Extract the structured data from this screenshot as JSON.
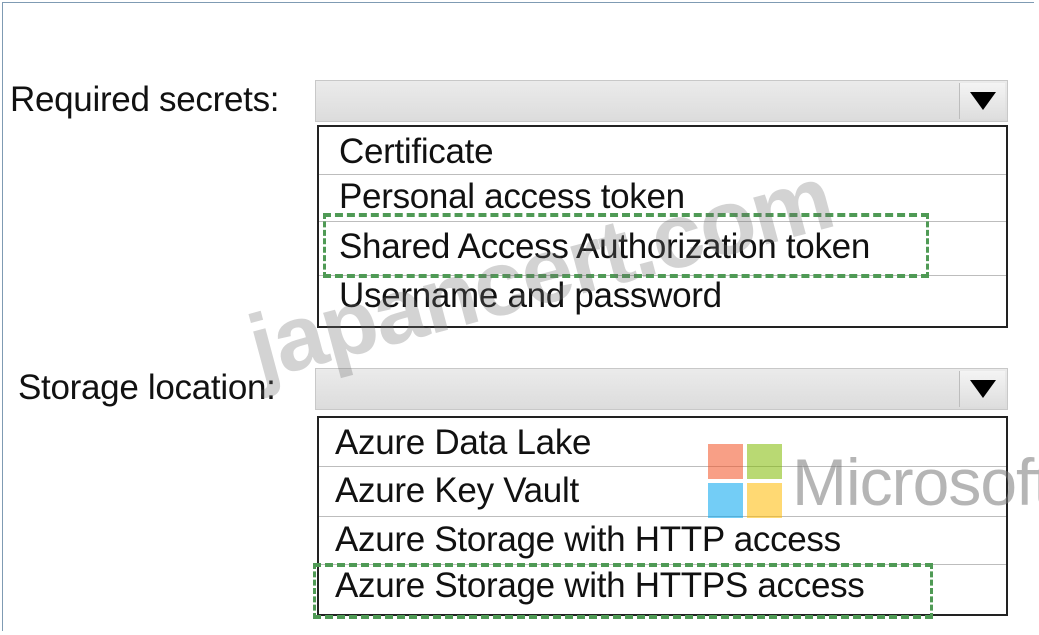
{
  "questions": [
    {
      "label": "Required secrets:",
      "options": [
        "Certificate",
        "Personal access token",
        "Shared Access Authorization token",
        "Username and password"
      ],
      "highlighted_option": "Shared Access Authorization token"
    },
    {
      "label": "Storage location:",
      "options": [
        "Azure Data Lake",
        "Azure Key Vault",
        "Azure Storage with HTTP access",
        "Azure Storage with HTTPS access"
      ],
      "highlighted_option": "Azure Storage with HTTPS access"
    }
  ],
  "watermark": {
    "text": "japancert.com",
    "brand": "Microsoft"
  },
  "colors": {
    "highlight": "#4f9a55",
    "logo": [
      "#f25022",
      "#7fba00",
      "#00a4ef",
      "#ffb900"
    ]
  }
}
